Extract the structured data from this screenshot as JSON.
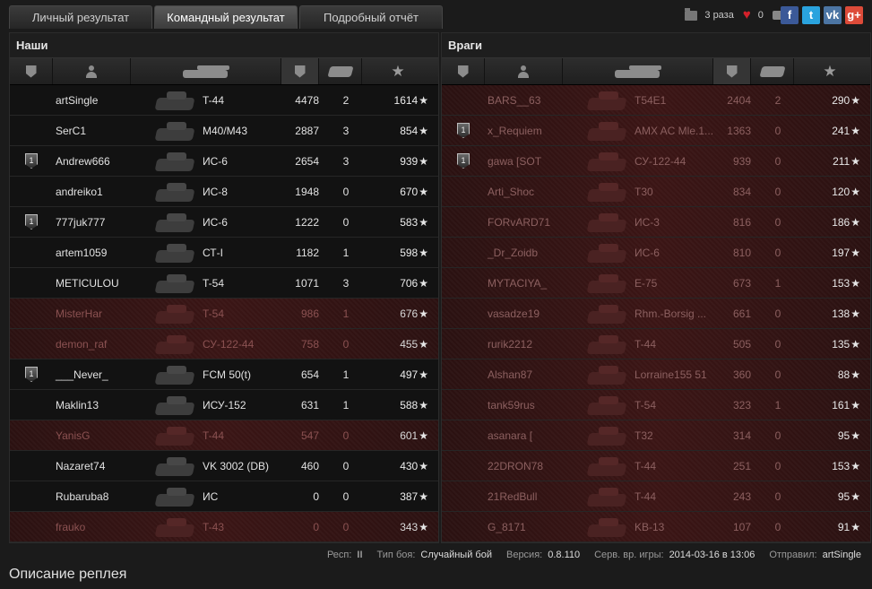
{
  "tabs": [
    "Личный результат",
    "Командный результат",
    "Подробный отчёт"
  ],
  "topstats": {
    "replays": "3 раза",
    "likes": "0",
    "comments": "0"
  },
  "social": [
    {
      "label": "f",
      "color": "#3b5998"
    },
    {
      "label": "t",
      "color": "#2aa3de"
    },
    {
      "label": "vk",
      "color": "#4c75a3"
    },
    {
      "label": "g+",
      "color": "#dd4b39"
    }
  ],
  "allies": {
    "title": "Наши",
    "rows": [
      {
        "rank": "",
        "name": "artSingle",
        "tank": "T-44",
        "xp": "4478",
        "kills": "2",
        "score": "1614",
        "dead": false
      },
      {
        "rank": "",
        "name": "SerC1",
        "tank": "M40/M43",
        "xp": "2887",
        "kills": "3",
        "score": "854",
        "dead": false
      },
      {
        "rank": "1",
        "name": "Andrew666",
        "tank": "ИС-6",
        "xp": "2654",
        "kills": "3",
        "score": "939",
        "dead": false
      },
      {
        "rank": "",
        "name": "andreiko1",
        "tank": "ИС-8",
        "xp": "1948",
        "kills": "0",
        "score": "670",
        "dead": false
      },
      {
        "rank": "1",
        "name": "777juk777",
        "tank": "ИС-6",
        "xp": "1222",
        "kills": "0",
        "score": "583",
        "dead": false
      },
      {
        "rank": "",
        "name": "artem1059",
        "tank": "СТ-I",
        "xp": "1182",
        "kills": "1",
        "score": "598",
        "dead": false
      },
      {
        "rank": "",
        "name": "METICULOU",
        "tank": "T-54",
        "xp": "1071",
        "kills": "3",
        "score": "706",
        "dead": false
      },
      {
        "rank": "",
        "name": "MisterHar",
        "tank": "T-54",
        "xp": "986",
        "kills": "1",
        "score": "676",
        "dead": true
      },
      {
        "rank": "",
        "name": "demon_raf",
        "tank": "СУ-122-44",
        "xp": "758",
        "kills": "0",
        "score": "455",
        "dead": true
      },
      {
        "rank": "1",
        "name": "___Never_",
        "tank": "FCM 50(t)",
        "xp": "654",
        "kills": "1",
        "score": "497",
        "dead": false
      },
      {
        "rank": "",
        "name": "Maklin13",
        "tank": "ИСУ-152",
        "xp": "631",
        "kills": "1",
        "score": "588",
        "dead": false
      },
      {
        "rank": "",
        "name": "YanisG",
        "tank": "T-44",
        "xp": "547",
        "kills": "0",
        "score": "601",
        "dead": true
      },
      {
        "rank": "",
        "name": "Nazaret74",
        "tank": "VK 3002 (DB)",
        "xp": "460",
        "kills": "0",
        "score": "430",
        "dead": false
      },
      {
        "rank": "",
        "name": "Rubaruba8",
        "tank": "ИС",
        "xp": "0",
        "kills": "0",
        "score": "387",
        "dead": false
      },
      {
        "rank": "",
        "name": "frauko",
        "tank": "T-43",
        "xp": "0",
        "kills": "0",
        "score": "343",
        "dead": true
      }
    ]
  },
  "enemies": {
    "title": "Враги",
    "rows": [
      {
        "rank": "",
        "name": "BARS__63",
        "tank": "T54E1",
        "xp": "2404",
        "kills": "2",
        "score": "290"
      },
      {
        "rank": "1",
        "name": "x_Requiem",
        "tank": "AMX AC Mle.1...",
        "xp": "1363",
        "kills": "0",
        "score": "241"
      },
      {
        "rank": "1",
        "name": "gawa [SOT",
        "tank": "СУ-122-44",
        "xp": "939",
        "kills": "0",
        "score": "211"
      },
      {
        "rank": "",
        "name": "Arti_Shoc",
        "tank": "T30",
        "xp": "834",
        "kills": "0",
        "score": "120"
      },
      {
        "rank": "",
        "name": "FORvARD71",
        "tank": "ИС-3",
        "xp": "816",
        "kills": "0",
        "score": "186"
      },
      {
        "rank": "",
        "name": "_Dr_Zoidb",
        "tank": "ИС-6",
        "xp": "810",
        "kills": "0",
        "score": "197"
      },
      {
        "rank": "",
        "name": "MYTACIYA_",
        "tank": "E-75",
        "xp": "673",
        "kills": "1",
        "score": "153"
      },
      {
        "rank": "",
        "name": "vasadze19",
        "tank": "Rhm.-Borsig ...",
        "xp": "661",
        "kills": "0",
        "score": "138"
      },
      {
        "rank": "",
        "name": "rurik2212",
        "tank": "T-44",
        "xp": "505",
        "kills": "0",
        "score": "135"
      },
      {
        "rank": "",
        "name": "Alshan87",
        "tank": "Lorraine155 51",
        "xp": "360",
        "kills": "0",
        "score": "88"
      },
      {
        "rank": "",
        "name": "tank59rus",
        "tank": "T-54",
        "xp": "323",
        "kills": "1",
        "score": "161"
      },
      {
        "rank": "",
        "name": "asanara [",
        "tank": "T32",
        "xp": "314",
        "kills": "0",
        "score": "95"
      },
      {
        "rank": "",
        "name": "22DRON78",
        "tank": "T-44",
        "xp": "251",
        "kills": "0",
        "score": "153"
      },
      {
        "rank": "",
        "name": "21RedBull",
        "tank": "T-44",
        "xp": "243",
        "kills": "0",
        "score": "95"
      },
      {
        "rank": "",
        "name": "G_8171",
        "tank": "KB-13",
        "xp": "107",
        "kills": "0",
        "score": "91"
      }
    ]
  },
  "info": {
    "resp_label": "Респ:",
    "resp": "II",
    "type_label": "Тип боя:",
    "type": "Случайный бой",
    "ver_label": "Версия:",
    "ver": "0.8.110",
    "server_label": "Серв. вр. игры:",
    "server": "2014-03-16 в 13:06",
    "sent_label": "Отправил:",
    "sent": "artSingle"
  },
  "description_title": "Описание реплея"
}
